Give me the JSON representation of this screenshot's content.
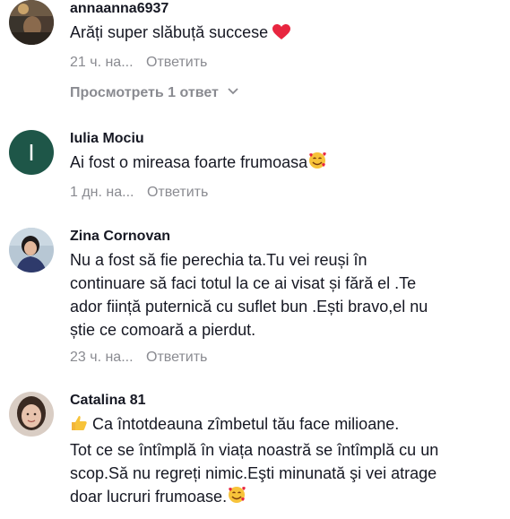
{
  "comments": [
    {
      "username": "annaanna6937",
      "text": "Arăți super slăbuță succese",
      "emoji": "heart-emoji",
      "time": "21 ч. на...",
      "reply_label": "Ответить",
      "view_replies_label": "Просмотреть 1 ответ"
    },
    {
      "username": "Iulia Mociu",
      "avatar_letter": "I",
      "avatar_color": "#1e5648",
      "text": "Ai fost o mireasa foarte frumoasa",
      "emoji": "smiling-face-with-hearts-emoji",
      "time": "1 дн. на...",
      "reply_label": "Ответить"
    },
    {
      "username": "Zina Cornovan",
      "text_lines": [
        "Nu a fost să fie perechia ta.Tu vei reuși în",
        "continuare să faci totul la ce ai visat și fără el .Te",
        "ador ființă puternică cu suflet bun .Ești bravo,el nu",
        "știe ce comoară a pierdut."
      ],
      "time": "23 ч. на...",
      "reply_label": "Ответить"
    },
    {
      "username": "Catalina 81",
      "emoji_lead": "thumbs-up-emoji",
      "text_lines": [
        "Ca întotdeauna zîmbetul tău face milioane.",
        "Tot ce se întîmplă în viața noastră se întîmplă cu un",
        "scop.Să nu regreți nimic.Eşti minunată şi vei atrage",
        "doar lucruri frumoase."
      ],
      "emoji": "smiling-face-with-hearts-emoji"
    }
  ],
  "colors": {
    "text": "#161823",
    "meta": "#8a8b91",
    "heart": "#fe2c55"
  }
}
